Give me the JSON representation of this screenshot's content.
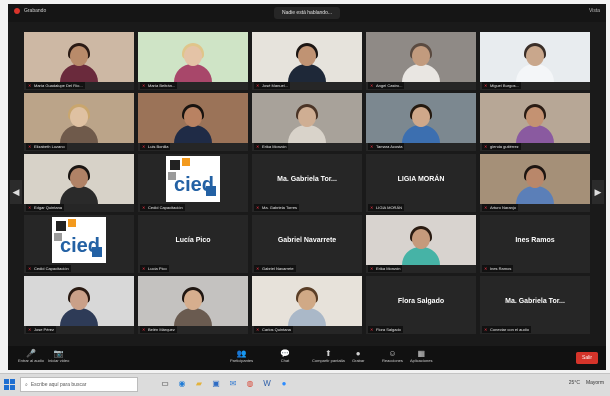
{
  "window": {
    "title": "Grabando",
    "speaking": "Nadie está hablando...",
    "view_label": "Vista"
  },
  "tiles": [
    {
      "type": "video",
      "name": "María Guadalupe Del Río...",
      "bg": "#cdb8a4",
      "skin": "#b98b6a",
      "hair": "#2a1a14",
      "shirt": "#6a2a3c"
    },
    {
      "type": "video",
      "name": "María Beltrán...",
      "bg": "#cfe4c6",
      "skin": "#e4c3a6",
      "hair": "#e0c58a",
      "shirt": "#a8476a"
    },
    {
      "type": "video",
      "name": "José Manuel...",
      "bg": "#e6e3dc",
      "skin": "#c09373",
      "hair": "#1c1613",
      "shirt": "#1e2838"
    },
    {
      "type": "video",
      "name": "Angel Castro...",
      "bg": "#8f8a86",
      "skin": "#c29b7e",
      "hair": "#5a4a40",
      "shirt": "#e9e6e2"
    },
    {
      "type": "video",
      "name": "Miguel Burgos...",
      "bg": "#e8ecef",
      "skin": "#c9a78c",
      "hair": "#3a2e28",
      "shirt": "#f4f6f8"
    },
    {
      "type": "video",
      "name": "Elizabeth Lozano",
      "bg": "#bba489",
      "skin": "#dfc1a2",
      "hair": "#c9a66e",
      "shirt": "#6f5a4b"
    },
    {
      "type": "video",
      "name": "Luis Bonilla",
      "bg": "#9b7358",
      "skin": "#b98262",
      "hair": "#18130f",
      "shirt": "#1f2b46"
    },
    {
      "type": "video",
      "name": "Erika Monzón",
      "bg": "#a8a29a",
      "skin": "#cfae93",
      "hair": "#4a3426",
      "shirt": "#d9d3ca"
    },
    {
      "type": "video",
      "name": "Tamara Acosta",
      "bg": "#7c8890",
      "skin": "#cfa88a",
      "hair": "#24190f",
      "shirt": "#3c6fb0"
    },
    {
      "type": "video",
      "name": "glenda gutiérrez",
      "bg": "#b7a796",
      "skin": "#c49272",
      "hair": "#2a1c14",
      "shirt": "#8a5aa0"
    },
    {
      "type": "video",
      "name": "Edgar Quintana",
      "bg": "#d7d2c8",
      "skin": "#b08266",
      "hair": "#1a1512",
      "shirt": "#2a2a2a"
    },
    {
      "type": "logo",
      "name": "Cedid Capacitación"
    },
    {
      "type": "name",
      "big": "Ma. Gabriela Tor...",
      "name": "Ma. Gabriela Torres"
    },
    {
      "type": "name",
      "big": "LIGIA MORÁN",
      "name": "LIGIA MORÁN"
    },
    {
      "type": "video",
      "name": "Arturo Naranjo",
      "bg": "#a59078",
      "skin": "#b9876a",
      "hair": "#1d1511",
      "shirt": "#5b7fb8"
    },
    {
      "type": "logo",
      "name": "Cedid Capacitación"
    },
    {
      "type": "name",
      "big": "Lucía Pico",
      "name": "Lucía Pico"
    },
    {
      "type": "name",
      "big": "Gabriel Navarrete",
      "name": "Gabriel Navarrete"
    },
    {
      "type": "video",
      "name": "Erika Monzón",
      "bg": "#d8d3cf",
      "skin": "#c69a7c",
      "hair": "#2a1b12",
      "shirt": "#46b3a6"
    },
    {
      "type": "name",
      "big": "Ines Ramos",
      "name": "Ines Ramos"
    },
    {
      "type": "video",
      "name": "Jose Pérez",
      "bg": "#d8d8d8",
      "skin": "#caa088",
      "hair": "#2a1a12",
      "shirt": "#2e3b57"
    },
    {
      "type": "video",
      "name": "Belén Márquez",
      "bg": "#c4c2c0",
      "skin": "#d6ae8e",
      "hair": "#1f1611",
      "shirt": "#6a5b50"
    },
    {
      "type": "video",
      "name": "Carlos Quintana",
      "bg": "#e7e2da",
      "skin": "#d0a986",
      "hair": "#5a3e26",
      "shirt": "#aab8c8"
    },
    {
      "type": "name",
      "big": "Flora Salgado",
      "name": "Flora Salgado"
    },
    {
      "type": "name",
      "big": "Ma. Gabriela Tor...",
      "name": "Conectar con el audio"
    }
  ],
  "toolbar": {
    "items": [
      {
        "icon": "mic-icon",
        "glyph": "🎤",
        "label": "Entrar al audio"
      },
      {
        "icon": "video-icon",
        "glyph": "📷",
        "label": "Iniciar video"
      },
      {
        "icon": "participants-icon",
        "glyph": "👥",
        "label": "Participantes"
      },
      {
        "icon": "chat-icon",
        "glyph": "💬",
        "label": "Chat"
      },
      {
        "icon": "share-screen-icon",
        "glyph": "⬆",
        "label": "Compartir pantalla"
      },
      {
        "icon": "record-icon",
        "glyph": "●",
        "label": "Grabar"
      },
      {
        "icon": "reactions-icon",
        "glyph": "☺",
        "label": "Reacciones"
      },
      {
        "icon": "apps-icon",
        "glyph": "▦",
        "label": "Aplicaciones"
      }
    ],
    "end_label": "Salir",
    "participants_count": "44"
  },
  "taskbar": {
    "search_placeholder": "Escribe aquí para buscar",
    "temperature": "25°C",
    "weather": "Mayorm"
  }
}
